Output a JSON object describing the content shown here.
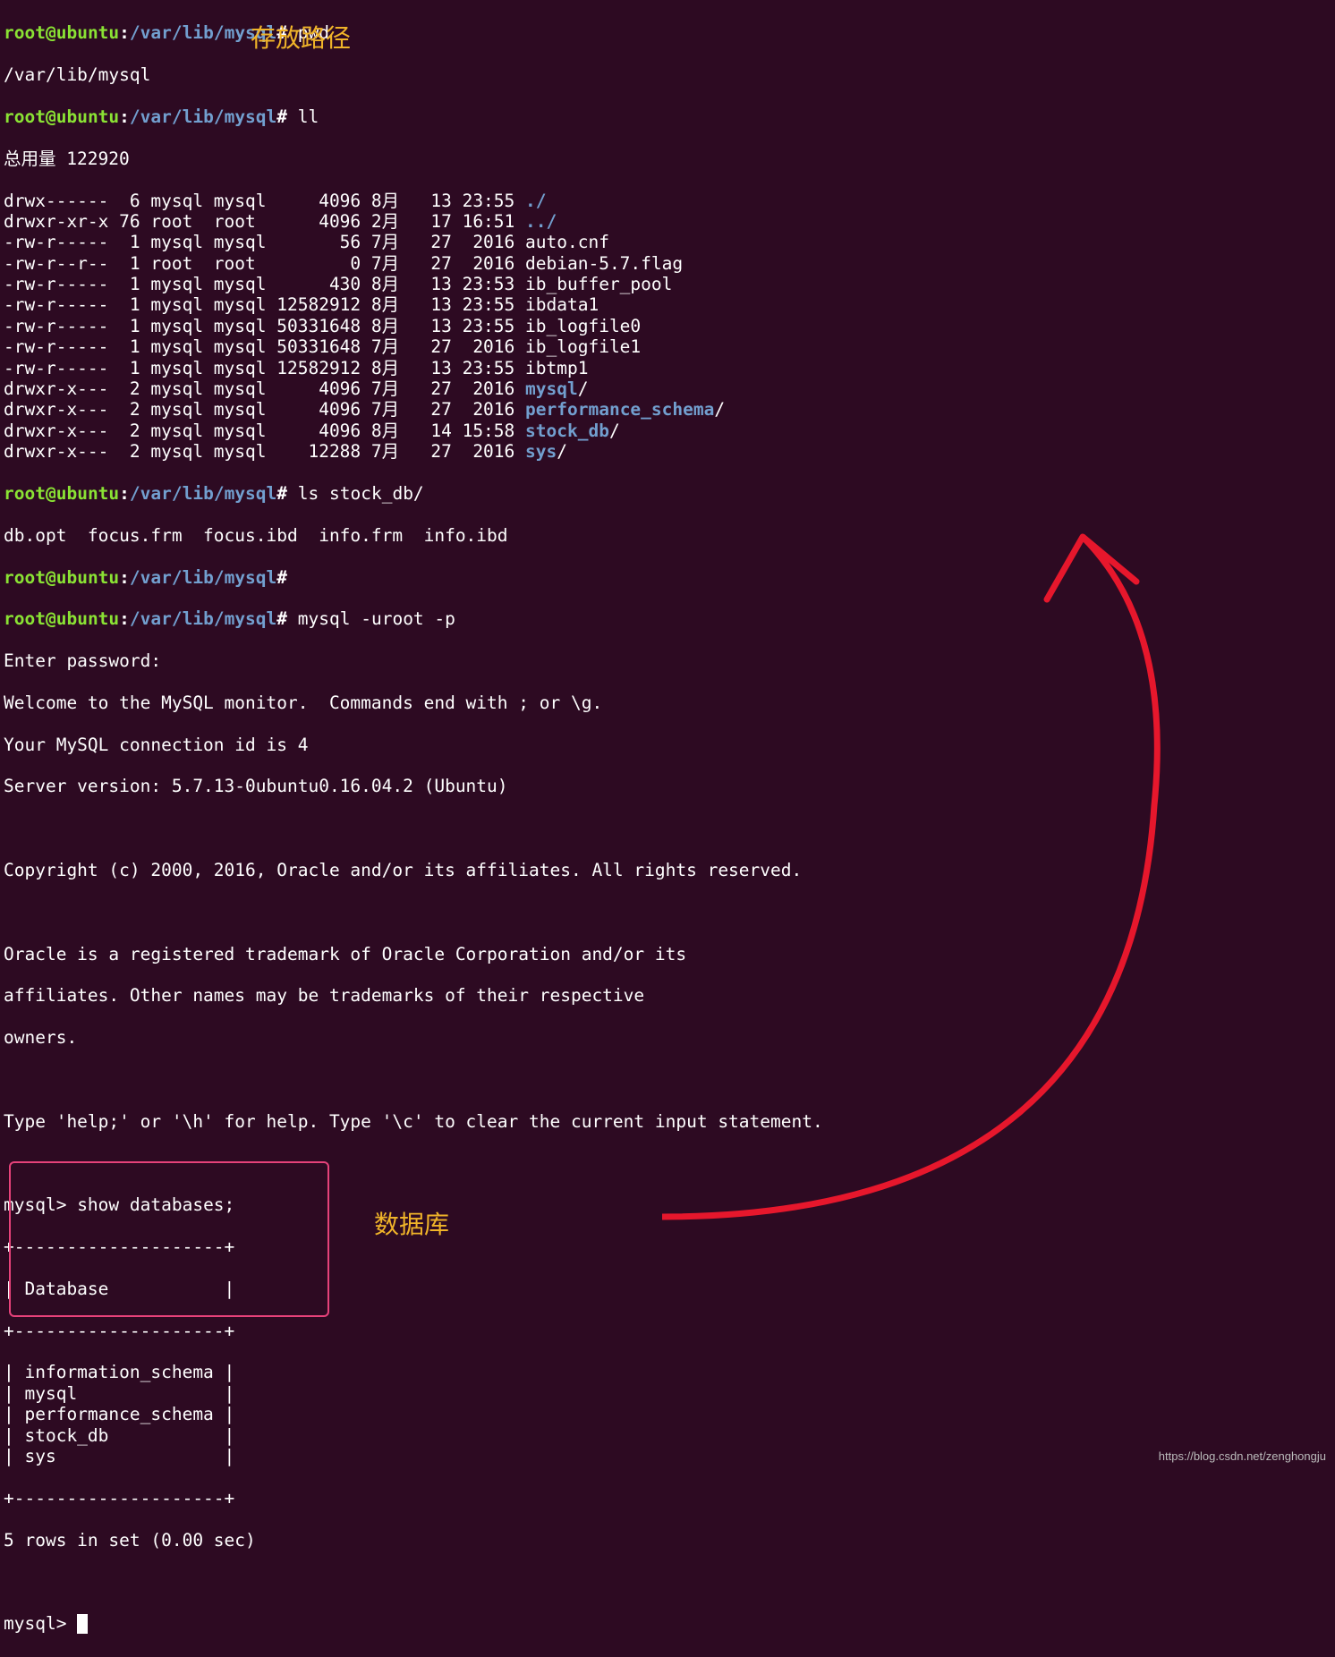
{
  "prompt": {
    "user": "root",
    "host": "ubuntu",
    "path": "/var/lib/mysql",
    "sep1": "@",
    "sep2": ":",
    "sep3": "#"
  },
  "commands": {
    "pwd": "pwd",
    "pwd_out": "/var/lib/mysql",
    "ll": "ll",
    "ls": "ls stock_db/",
    "ls_out": "db.opt  focus.frm  focus.ibd  info.frm  info.ibd",
    "blank": "",
    "mysql": "mysql -uroot -p"
  },
  "annotations": {
    "storage_path": "存放路径",
    "database": "数据库"
  },
  "ll_header": "总用量 122920",
  "ll_rows": [
    {
      "perm": "drwx------",
      "n": " 6",
      "own": "mysql",
      "grp": "mysql",
      "size": "    4096",
      "mon": "8月",
      "day": "  13",
      "time": "23:55",
      "name": "./",
      "isdir": true
    },
    {
      "perm": "drwxr-xr-x",
      "n": "76",
      "own": "root ",
      "grp": "root ",
      "size": "    4096",
      "mon": "2月",
      "day": "  17",
      "time": "16:51",
      "name": "../",
      "isdir": true
    },
    {
      "perm": "-rw-r-----",
      "n": " 1",
      "own": "mysql",
      "grp": "mysql",
      "size": "      56",
      "mon": "7月",
      "day": "  27",
      "time": " 2016",
      "name": "auto.cnf",
      "isdir": false
    },
    {
      "perm": "-rw-r--r--",
      "n": " 1",
      "own": "root ",
      "grp": "root ",
      "size": "       0",
      "mon": "7月",
      "day": "  27",
      "time": " 2016",
      "name": "debian-5.7.flag",
      "isdir": false
    },
    {
      "perm": "-rw-r-----",
      "n": " 1",
      "own": "mysql",
      "grp": "mysql",
      "size": "     430",
      "mon": "8月",
      "day": "  13",
      "time": "23:53",
      "name": "ib_buffer_pool",
      "isdir": false
    },
    {
      "perm": "-rw-r-----",
      "n": " 1",
      "own": "mysql",
      "grp": "mysql",
      "size": "12582912",
      "mon": "8月",
      "day": "  13",
      "time": "23:55",
      "name": "ibdata1",
      "isdir": false
    },
    {
      "perm": "-rw-r-----",
      "n": " 1",
      "own": "mysql",
      "grp": "mysql",
      "size": "50331648",
      "mon": "8月",
      "day": "  13",
      "time": "23:55",
      "name": "ib_logfile0",
      "isdir": false
    },
    {
      "perm": "-rw-r-----",
      "n": " 1",
      "own": "mysql",
      "grp": "mysql",
      "size": "50331648",
      "mon": "7月",
      "day": "  27",
      "time": " 2016",
      "name": "ib_logfile1",
      "isdir": false
    },
    {
      "perm": "-rw-r-----",
      "n": " 1",
      "own": "mysql",
      "grp": "mysql",
      "size": "12582912",
      "mon": "8月",
      "day": "  13",
      "time": "23:55",
      "name": "ibtmp1",
      "isdir": false
    },
    {
      "perm": "drwxr-x---",
      "n": " 2",
      "own": "mysql",
      "grp": "mysql",
      "size": "    4096",
      "mon": "7月",
      "day": "  27",
      "time": " 2016",
      "name": "mysql",
      "isdir": true,
      "slash": "/"
    },
    {
      "perm": "drwxr-x---",
      "n": " 2",
      "own": "mysql",
      "grp": "mysql",
      "size": "    4096",
      "mon": "7月",
      "day": "  27",
      "time": " 2016",
      "name": "performance_schema",
      "isdir": true,
      "slash": "/"
    },
    {
      "perm": "drwxr-x---",
      "n": " 2",
      "own": "mysql",
      "grp": "mysql",
      "size": "    4096",
      "mon": "8月",
      "day": "  14",
      "time": "15:58",
      "name": "stock_db",
      "isdir": true,
      "slash": "/"
    },
    {
      "perm": "drwxr-x---",
      "n": " 2",
      "own": "mysql",
      "grp": "mysql",
      "size": "   12288",
      "mon": "7月",
      "day": "  27",
      "time": " 2016",
      "name": "sys",
      "isdir": true,
      "slash": "/"
    }
  ],
  "mysql_session": {
    "enter_pw": "Enter password:",
    "welcome": "Welcome to the MySQL monitor.  Commands end with ; or \\g.",
    "conn_id": "Your MySQL connection id is 4",
    "version": "Server version: 5.7.13-0ubuntu0.16.04.2 (Ubuntu)",
    "copyright": "Copyright (c) 2000, 2016, Oracle and/or its affiliates. All rights reserved.",
    "trademark1": "Oracle is a registered trademark of Oracle Corporation and/or its",
    "trademark2": "affiliates. Other names may be trademarks of their respective",
    "trademark3": "owners.",
    "help": "Type 'help;' or '\\h' for help. Type '\\c' to clear the current input statement.",
    "prompt": "mysql> ",
    "show_db": "show databases;",
    "border": "+--------------------+",
    "header": "| Database           |",
    "rows": [
      "| information_schema |",
      "| mysql              |",
      "| performance_schema |",
      "| stock_db           |",
      "| sys                |"
    ],
    "footer": "5 rows in set (0.00 sec)"
  },
  "watermark": "https://blog.csdn.net/zenghongju"
}
